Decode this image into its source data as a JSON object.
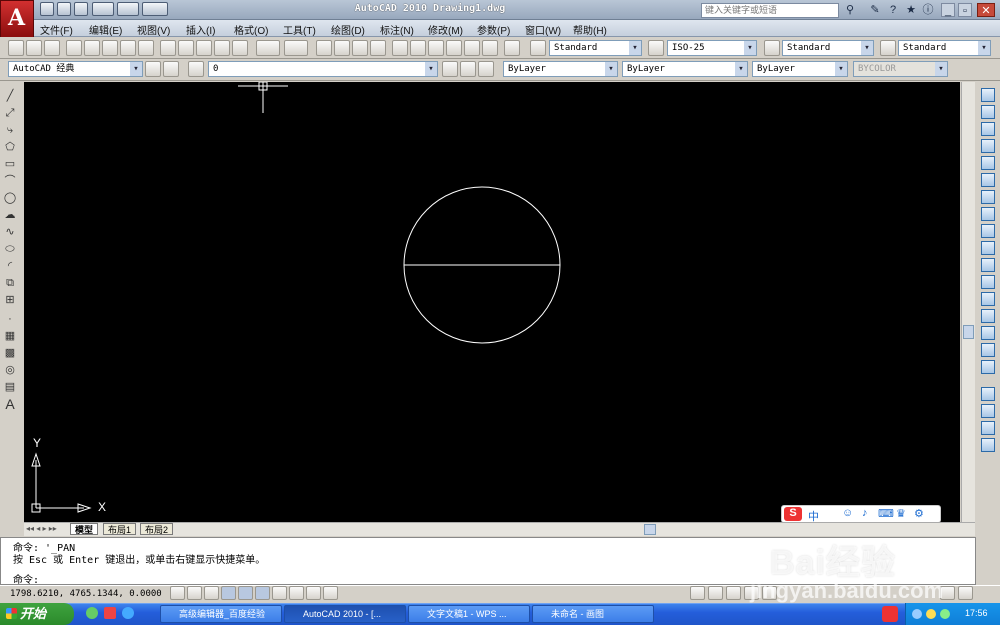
{
  "window": {
    "title": "AutoCAD 2010   Drawing1.dwg",
    "search_placeholder": "键入关键字或短语"
  },
  "menu": [
    "文件(F)",
    "编辑(E)",
    "视图(V)",
    "插入(I)",
    "格式(O)",
    "工具(T)",
    "绘图(D)",
    "标注(N)",
    "修改(M)",
    "参数(P)",
    "窗口(W)",
    "帮助(H)"
  ],
  "styles": {
    "text_style": "Standard",
    "dim_style": "ISO-25",
    "table_style": "Standard",
    "mleader_style": "Standard"
  },
  "workspace": "AutoCAD 经典",
  "layer": "0",
  "properties": {
    "color": "ByLayer",
    "linetype": "ByLayer",
    "lineweight": "ByLayer",
    "plotstyle": "BYCOLOR"
  },
  "ucs": {
    "y_label": "Y",
    "x_label": "X"
  },
  "layout_tabs": [
    "模型",
    "布局1",
    "布局2"
  ],
  "command": {
    "history1": "命令: '_PAN",
    "history2": "按 Esc 或 Enter 键退出，或单击右键显示快捷菜单。",
    "prompt": "命令:"
  },
  "status": {
    "coords": "1798.6210, 4765.1344, 0.0000"
  },
  "taskbar": {
    "start": "开始",
    "tasks": [
      "高级编辑器_百度经验",
      "AutoCAD 2010 - [...",
      "文字文稿1 - WPS ...",
      "未命名 - 画图"
    ],
    "clock": "17:56"
  },
  "watermark": {
    "line1": "Bai经验",
    "line2": "jingyan.baidu.com"
  },
  "ime": {
    "label": "中"
  }
}
